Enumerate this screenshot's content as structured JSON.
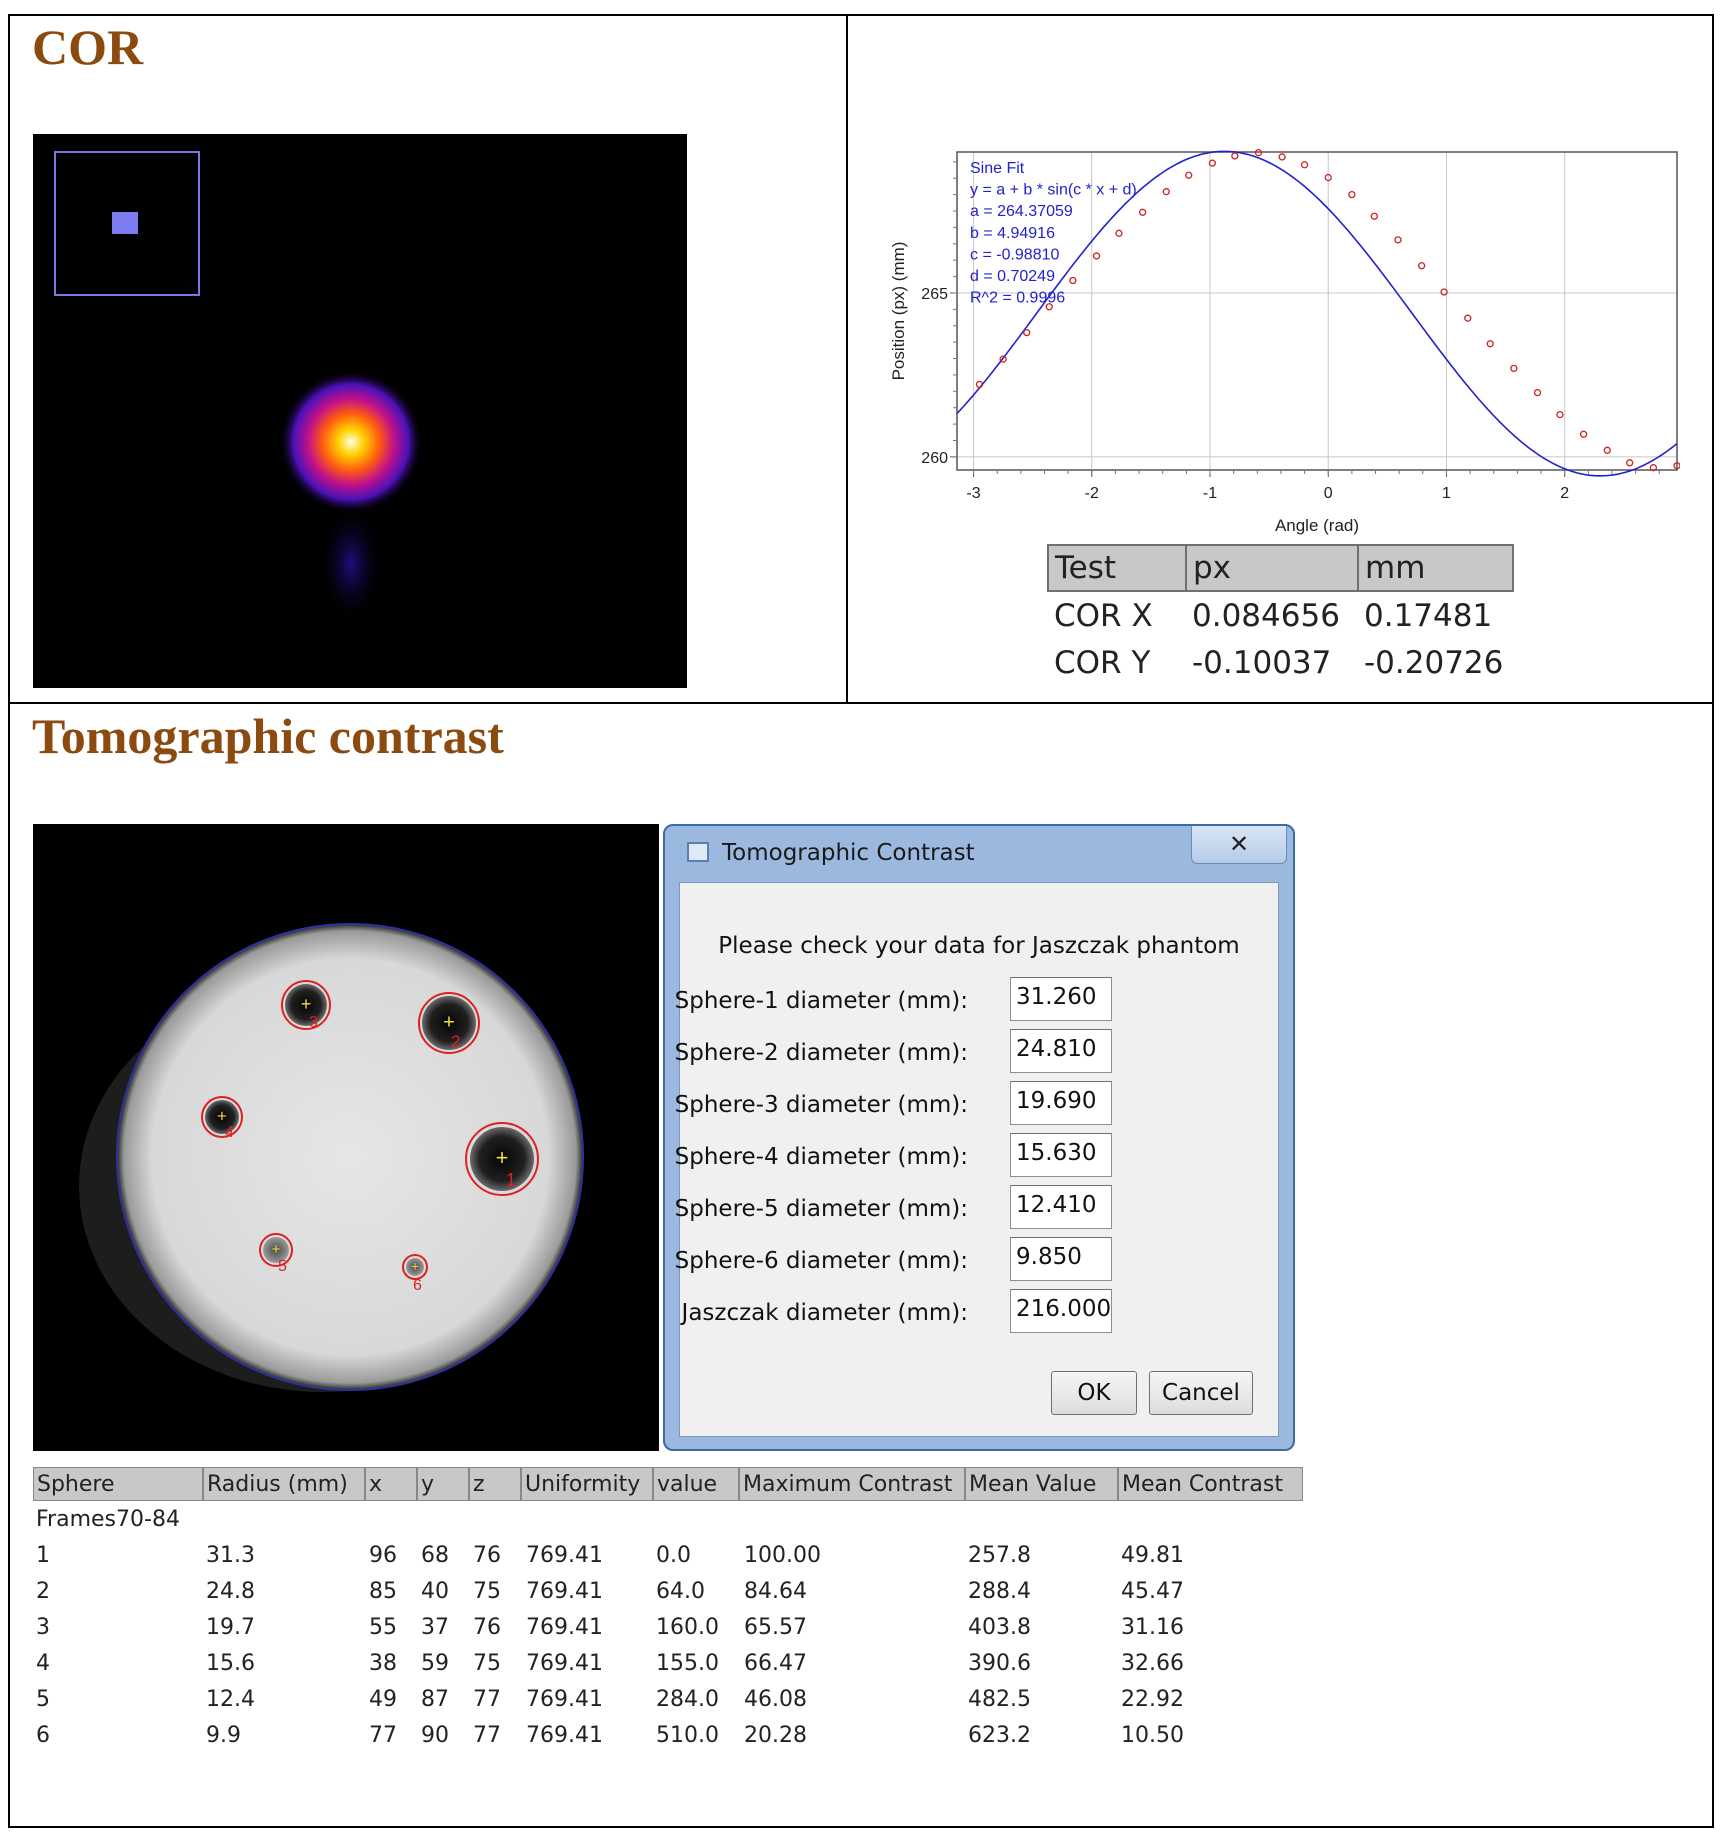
{
  "sections": {
    "cor_title": "COR",
    "tomo_title": "Tomographic contrast"
  },
  "chart_data": {
    "type": "scatter",
    "title": "",
    "xlabel": "Angle (rad)",
    "ylabel": "Position (px) (mm)",
    "xlim": [
      -3.14,
      2.95
    ],
    "ylim": [
      259.6,
      269.3
    ],
    "xticks": [
      "-3",
      "-2",
      "-1",
      "0",
      "1",
      "2"
    ],
    "xtick_values": [
      -3,
      -2,
      -1,
      0,
      1,
      2
    ],
    "yticks": [
      "260",
      "265"
    ],
    "ytick_values": [
      260,
      265
    ],
    "grid": true,
    "fit": {
      "a": 264.37059,
      "b": 4.94916,
      "c": -0.9881,
      "d": 0.70249
    },
    "fit_color": "#2222cc",
    "point_color": "#cc2222",
    "legend": [
      "Sine Fit",
      "y = a + b * sin(c * x + d)",
      "a = 264.37059",
      "b = 4.94916",
      "c = -0.98810",
      "d = 0.70249",
      "R^2 = 0.9996"
    ],
    "x": [
      -2.95,
      -2.75,
      -2.55,
      -2.36,
      -2.16,
      -1.96,
      -1.77,
      -1.57,
      -1.37,
      -1.18,
      -0.98,
      -0.79,
      -0.59,
      -0.39,
      -0.2,
      0.0,
      0.2,
      0.39,
      0.59,
      0.79,
      0.98,
      1.18,
      1.37,
      1.57,
      1.77,
      1.96,
      2.16,
      2.36,
      2.55,
      2.75,
      2.95
    ],
    "y": [
      262.21,
      262.98,
      263.79,
      264.58,
      265.38,
      266.13,
      266.82,
      267.46,
      268.09,
      268.59,
      268.96,
      269.18,
      269.28,
      269.15,
      268.91,
      268.52,
      268.0,
      267.34,
      266.62,
      265.83,
      265.03,
      264.23,
      263.45,
      262.7,
      261.96,
      261.29,
      260.69,
      260.2,
      259.82,
      259.67,
      259.73
    ]
  },
  "cor_table": {
    "headers": [
      "Test",
      "px",
      "mm"
    ],
    "rows": [
      [
        "COR X",
        "0.084656",
        "0.17481"
      ],
      [
        "COR Y",
        "-0.10037",
        "-0.20726"
      ]
    ]
  },
  "dialog": {
    "title": "Tomographic Contrast",
    "close_label": "✕",
    "message": "Please check your data for Jaszczak phantom",
    "fields": [
      {
        "label": "Sphere-1 diameter (mm):",
        "value": "31.260"
      },
      {
        "label": "Sphere-2 diameter (mm):",
        "value": "24.810"
      },
      {
        "label": "Sphere-3 diameter (mm):",
        "value": "19.690"
      },
      {
        "label": "Sphere-4 diameter (mm):",
        "value": "15.630"
      },
      {
        "label": "Sphere-5 diameter (mm):",
        "value": "12.410"
      },
      {
        "label": "Sphere-6 diameter (mm):",
        "value": "9.850"
      },
      {
        "label": "Jaszczak diameter (mm):",
        "value": "216.000"
      }
    ],
    "ok_label": "OK",
    "cancel_label": "Cancel"
  },
  "phantom": {
    "sphere_labels": [
      "1",
      "2",
      "3",
      "4",
      "5",
      "6"
    ],
    "roi_color": "#dd2222",
    "outline_color": "#3030a0"
  },
  "results": {
    "headers": [
      "Sphere",
      "Radius (mm)",
      "x",
      "y",
      "z",
      "Uniformity",
      "value",
      "Maximum Contrast",
      "Mean Value",
      "Mean Contrast"
    ],
    "group_label": "Frames70-84",
    "rows": [
      [
        "1",
        "31.3",
        "96",
        "68",
        "76",
        "769.41",
        "0.0",
        "100.00",
        "257.8",
        "49.81"
      ],
      [
        "2",
        "24.8",
        "85",
        "40",
        "75",
        "769.41",
        "64.0",
        "84.64",
        "288.4",
        "45.47"
      ],
      [
        "3",
        "19.7",
        "55",
        "37",
        "76",
        "769.41",
        "160.0",
        "65.57",
        "403.8",
        "31.16"
      ],
      [
        "4",
        "15.6",
        "38",
        "59",
        "75",
        "769.41",
        "155.0",
        "66.47",
        "390.6",
        "32.66"
      ],
      [
        "5",
        "12.4",
        "49",
        "87",
        "77",
        "769.41",
        "284.0",
        "46.08",
        "482.5",
        "22.92"
      ],
      [
        "6",
        "9.9",
        "77",
        "90",
        "77",
        "769.41",
        "510.0",
        "20.28",
        "623.2",
        "10.50"
      ]
    ]
  }
}
